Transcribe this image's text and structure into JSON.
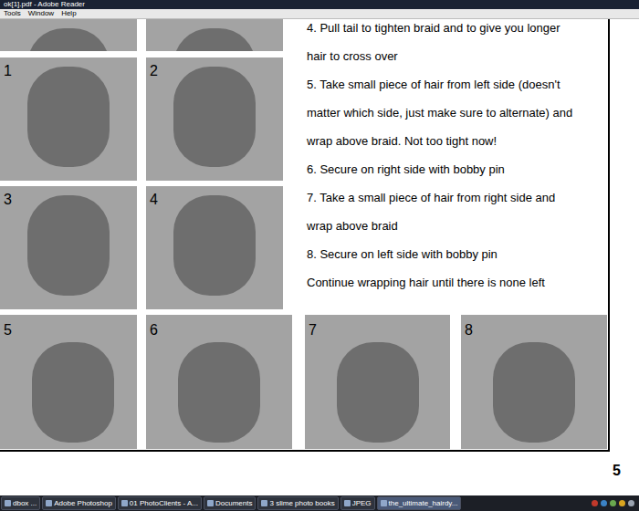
{
  "window": {
    "title": "ok[1].pdf - Adobe Reader"
  },
  "menu": [
    "Tools",
    "Window",
    "Help"
  ],
  "page": {
    "photo_rows": [
      [
        {
          "label": ""
        },
        {
          "label": ""
        }
      ],
      [
        {
          "label": "1"
        },
        {
          "label": "2"
        }
      ],
      [
        {
          "label": "3"
        },
        {
          "label": "4"
        }
      ]
    ],
    "bottom_photos": [
      {
        "label": "5"
      },
      {
        "label": "6"
      },
      {
        "label": "7"
      },
      {
        "label": "8"
      }
    ],
    "instructions": [
      "4. Pull tail to tighten braid and to give you longer",
      "hair to cross over",
      "5. Take small piece of hair from left side (doesn't",
      "matter which side, just make sure to alternate) and",
      "wrap above braid.  Not too tight now!",
      "6. Secure on right side with bobby pin",
      "7. Take a small piece of hair from right side and",
      "wrap above braid",
      "8. Secure on left side with bobby pin",
      "Continue wrapping hair until there is none left"
    ],
    "page_number": "5"
  },
  "taskbar": [
    {
      "label": "dbox ...",
      "selected": false
    },
    {
      "label": "Adobe Photoshop",
      "selected": false
    },
    {
      "label": "01 PhotoClients - A...",
      "selected": false
    },
    {
      "label": "Documents",
      "selected": false
    },
    {
      "label": "3 slime photo books",
      "selected": false
    },
    {
      "label": "JPEG",
      "selected": false
    },
    {
      "label": "the_ultimate_hairdy...",
      "selected": true
    }
  ]
}
